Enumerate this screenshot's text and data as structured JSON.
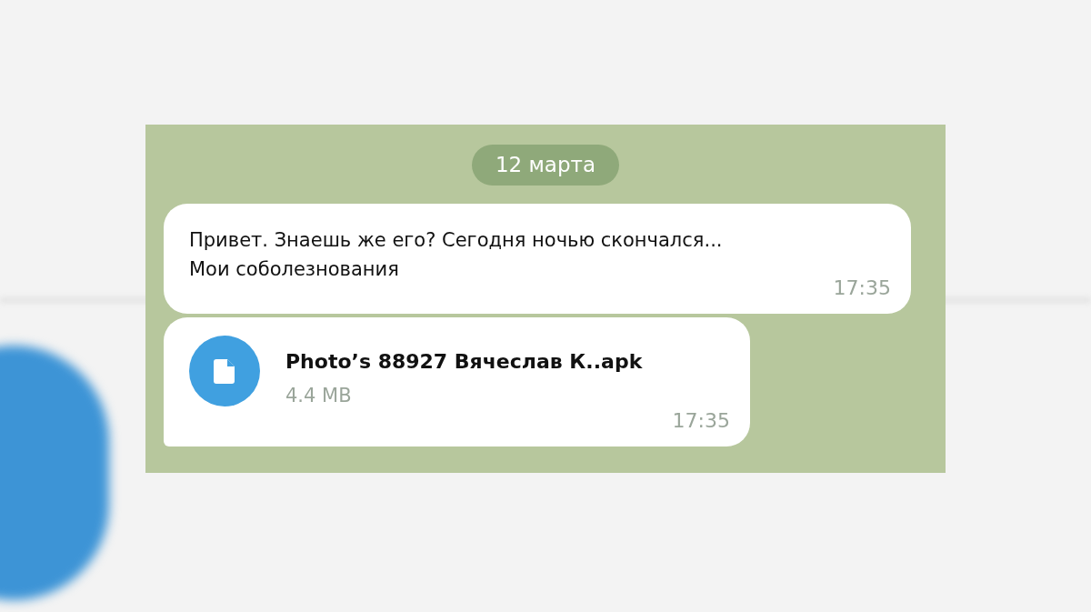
{
  "chat": {
    "date_label": "12 марта",
    "messages": [
      {
        "kind": "text",
        "text": "Привет. Знаешь же его? Сегодня ночью скончался...\nМои соболезнования",
        "time": "17:35"
      },
      {
        "kind": "file",
        "file_name": "Photo’s 88927 Вячеслав К..apk",
        "size": "4.4 MB",
        "time": "17:35"
      }
    ]
  }
}
